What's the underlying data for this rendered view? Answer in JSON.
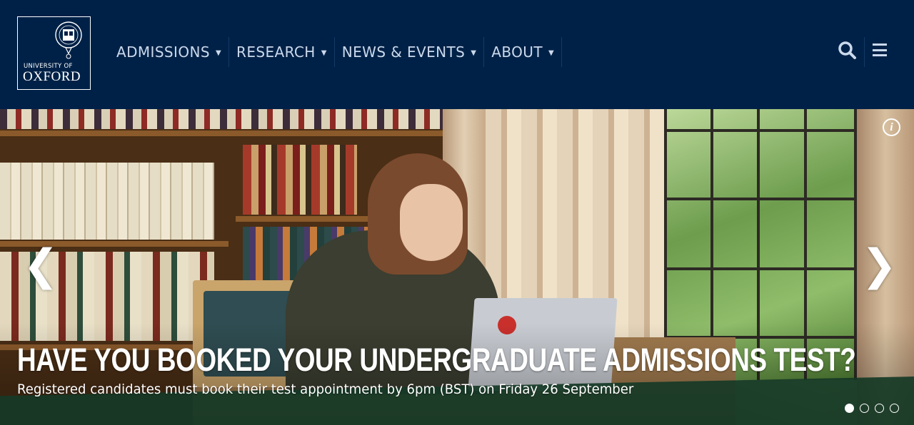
{
  "brand": {
    "line1": "UNIVERSITY OF",
    "line2": "OXFORD",
    "logo_icon": "oxford-crest-icon"
  },
  "nav": {
    "items": [
      {
        "label": "ADMISSIONS",
        "icon": "caret-down-icon"
      },
      {
        "label": "RESEARCH",
        "icon": "caret-down-icon"
      },
      {
        "label": "NEWS & EVENTS",
        "icon": "caret-down-icon"
      },
      {
        "label": "ABOUT",
        "icon": "caret-down-icon"
      }
    ],
    "search_icon": "search-icon",
    "menu_icon": "hamburger-menu-icon"
  },
  "hero": {
    "title": "HAVE YOU BOOKED YOUR UNDERGRADUATE ADMISSIONS TEST?",
    "subtitle": "Registered candidates must book their test appointment by 6pm (BST) on Friday 26 September",
    "prev_arrow": "❮",
    "next_arrow": "❯",
    "info_label": "i",
    "slides_total": 4,
    "active_slide": 1
  },
  "colors": {
    "oxford_blue": "#002147",
    "nav_text": "#cbd9ec",
    "white": "#ffffff"
  }
}
